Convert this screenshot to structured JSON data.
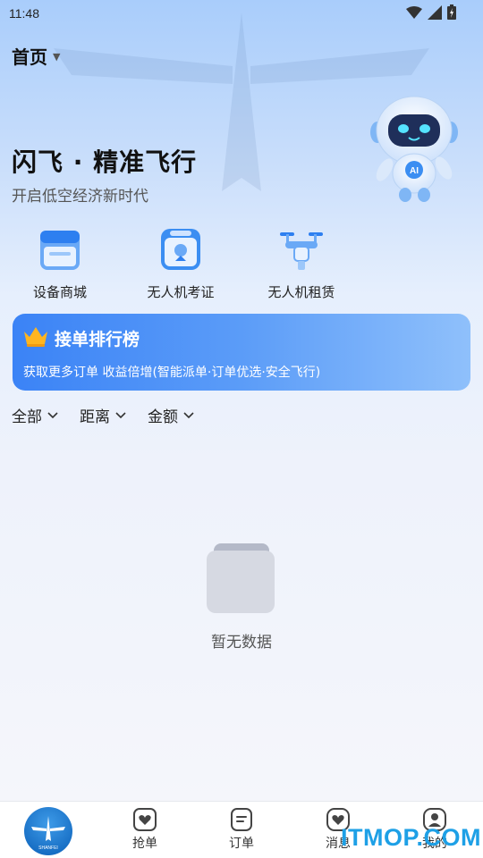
{
  "status_bar": {
    "time": "11:48"
  },
  "location": {
    "label": "首页"
  },
  "hero": {
    "title": "闪飞 · 精准飞行",
    "subtitle": "开启低空经济新时代",
    "robot_badge": "AI"
  },
  "services": [
    {
      "label": "设备商城",
      "icon": "store-icon"
    },
    {
      "label": "无人机考证",
      "icon": "certificate-icon"
    },
    {
      "label": "无人机租赁",
      "icon": "drone-icon"
    }
  ],
  "banner": {
    "title": "接单排行榜",
    "subtitle": "获取更多订单 收益倍增(智能派单·订单优选·安全飞行)",
    "accent_color": "#3b83f6"
  },
  "filters": [
    {
      "label": "全部"
    },
    {
      "label": "距离"
    },
    {
      "label": "金额"
    }
  ],
  "empty_state": {
    "text": "暂无数据"
  },
  "tabbar": {
    "home_logo_text": "SHANFEI",
    "tabs": [
      {
        "label": "抢单",
        "icon": "heart-tag-icon"
      },
      {
        "label": "订单",
        "icon": "document-icon"
      },
      {
        "label": "消息",
        "icon": "message-icon"
      },
      {
        "label": "我的",
        "icon": "profile-icon"
      }
    ]
  },
  "watermark": "ITMOP.COM"
}
